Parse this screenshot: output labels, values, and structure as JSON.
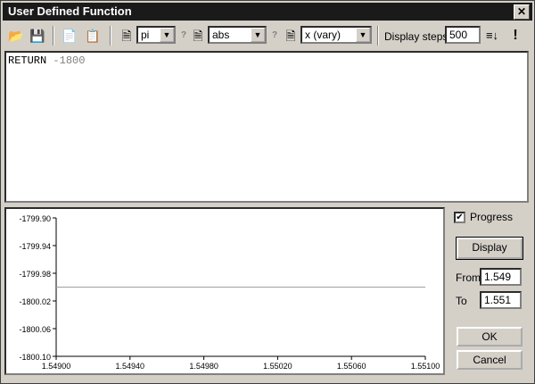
{
  "window": {
    "title": "User Defined Function",
    "close_glyph": "✕"
  },
  "toolbar": {
    "combo1_value": "pi",
    "combo2_value": "abs",
    "combo3_value": "x  (vary)",
    "display_steps_label": "Display steps",
    "display_steps_value": "500",
    "qmark": "?",
    "dropdown_arrow": "▼",
    "run_glyph": "!"
  },
  "editor": {
    "keyword": "RETURN",
    "value": "-1800"
  },
  "side": {
    "progress_label": "Progress",
    "progress_checked": true,
    "check_glyph": "✔",
    "display_button": "Display",
    "from_label": "From",
    "from_value": "1.549",
    "to_label": "To",
    "to_value": "1.551",
    "ok_button": "OK",
    "cancel_button": "Cancel"
  },
  "chart_data": {
    "type": "line",
    "x_ticks": [
      "1.54900",
      "1.54940",
      "1.54980",
      "1.55020",
      "1.55060",
      "1.55100"
    ],
    "y_ticks": [
      "-1799.90",
      "-1799.94",
      "-1799.98",
      "-1800.02",
      "-1800.06",
      "-1800.10"
    ],
    "xlim": [
      1.549,
      1.551
    ],
    "ylim": [
      -1800.1,
      -1799.9
    ],
    "series": [
      {
        "x": [
          1.549,
          1.551
        ],
        "y": [
          -1800.0,
          -1800.0
        ]
      }
    ],
    "line_color": "#a0a0a0",
    "grid": false
  }
}
